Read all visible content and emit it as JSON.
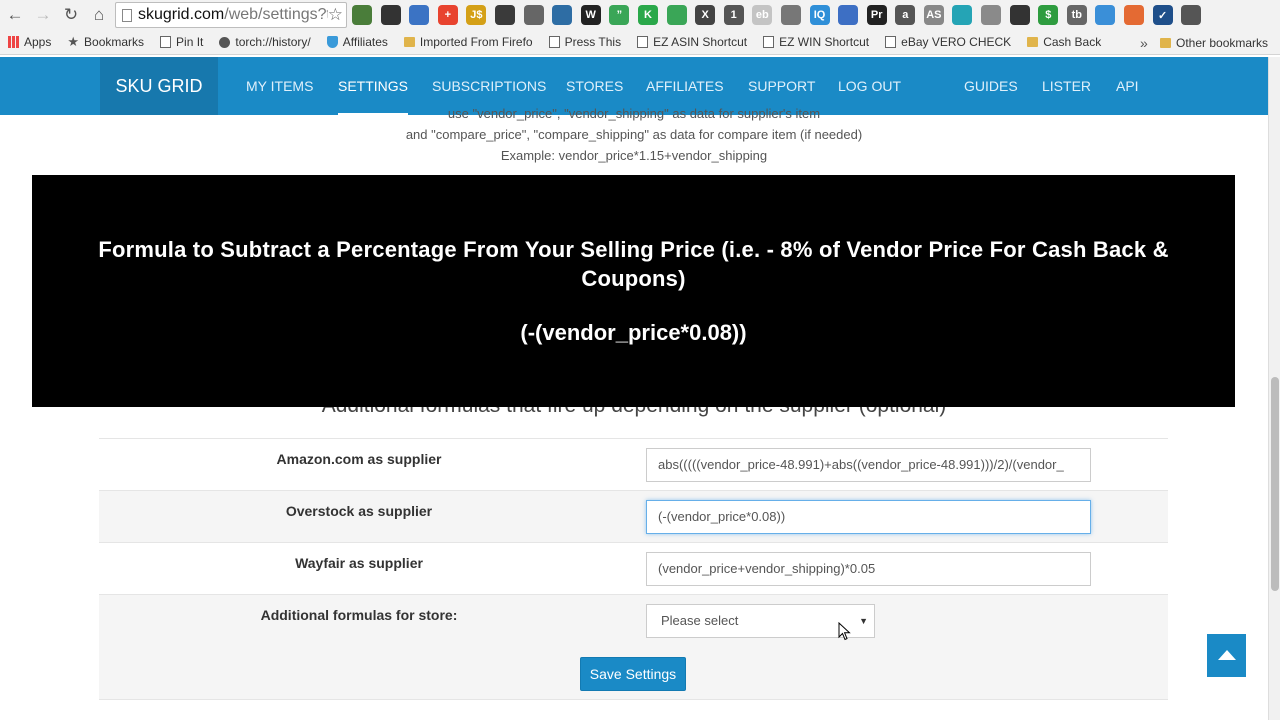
{
  "browser": {
    "url_host": "skugrid.com",
    "url_path": "/web/settings?t",
    "extensions": [
      {
        "icon": "eyedropper-icon",
        "glyph": "",
        "color": "#4a7d3a"
      },
      {
        "icon": "magnifier-icon",
        "glyph": "",
        "color": "#333333"
      },
      {
        "icon": "download-arrow-icon",
        "glyph": "",
        "color": "#3b73c4"
      },
      {
        "icon": "plus-circle-icon",
        "glyph": "+",
        "color": "#e8432f"
      },
      {
        "icon": "js-icon",
        "glyph": "J$",
        "color": "#d4a017"
      },
      {
        "icon": "terminal-icon",
        "glyph": "",
        "color": "#3a3a3a"
      },
      {
        "icon": "checklist-icon",
        "glyph": "",
        "color": "#666666"
      },
      {
        "icon": "chart-icon",
        "glyph": "",
        "color": "#2e6da4"
      },
      {
        "icon": "wordpress-w-icon",
        "glyph": "W",
        "color": "#222222"
      },
      {
        "icon": "quote-icon",
        "glyph": "”",
        "color": "#3aa657"
      },
      {
        "icon": "k-icon",
        "glyph": "K",
        "color": "#2aa84a"
      },
      {
        "icon": "pin-icon",
        "glyph": "",
        "color": "#3aa657"
      },
      {
        "icon": "x-icon",
        "glyph": "X",
        "color": "#444444"
      },
      {
        "icon": "eye-badge-icon",
        "glyph": "1",
        "color": "#555555"
      },
      {
        "icon": "ebay-icon",
        "glyph": "eb",
        "color": "#c4c4c4"
      },
      {
        "icon": "disc-icon",
        "glyph": "",
        "color": "#777777"
      },
      {
        "icon": "iq-icon",
        "glyph": "IQ",
        "color": "#2f8fd8"
      },
      {
        "icon": "globe-icon",
        "glyph": "",
        "color": "#3d6fc4"
      },
      {
        "icon": "pr-icon",
        "glyph": "Pr",
        "color": "#222222"
      },
      {
        "icon": "amazon-icon",
        "glyph": "a",
        "color": "#555555"
      },
      {
        "icon": "asin-power-icon",
        "glyph": "AS",
        "color": "#888888"
      },
      {
        "icon": "bag-icon",
        "glyph": "",
        "color": "#25a4b5"
      },
      {
        "icon": "forward-arrow-icon",
        "glyph": "",
        "color": "#8a8a8a"
      },
      {
        "icon": "camera-icon",
        "glyph": "",
        "color": "#333333"
      },
      {
        "icon": "dollar-icon",
        "glyph": "$",
        "color": "#2e9c3f"
      },
      {
        "icon": "tb-icon",
        "glyph": "tb",
        "color": "#666666"
      },
      {
        "icon": "refresh-circle-icon",
        "glyph": "",
        "color": "#3a8fd8"
      },
      {
        "icon": "tag-icon",
        "glyph": "",
        "color": "#e46a33"
      },
      {
        "icon": "checkbox-icon",
        "glyph": "✓",
        "color": "#1f4f8a"
      },
      {
        "icon": "mail-icon",
        "glyph": "",
        "color": "#555555"
      }
    ],
    "bookmarks": [
      {
        "label": "Apps",
        "icon": "apps-grid-icon",
        "kind": "apps"
      },
      {
        "label": "Bookmarks",
        "icon": "star-icon",
        "kind": "star"
      },
      {
        "label": "Pin It",
        "icon": "page-icon",
        "kind": "page"
      },
      {
        "label": "torch://history/",
        "icon": "history-icon",
        "kind": "clock"
      },
      {
        "label": "Affiliates",
        "icon": "shield-icon",
        "kind": "shield"
      },
      {
        "label": "Imported From Firefo",
        "icon": "folder-icon",
        "kind": "folder"
      },
      {
        "label": "Press This",
        "icon": "page-icon",
        "kind": "page"
      },
      {
        "label": "EZ ASIN Shortcut",
        "icon": "page-icon",
        "kind": "page"
      },
      {
        "label": "EZ WIN Shortcut",
        "icon": "page-icon",
        "kind": "page"
      },
      {
        "label": "eBay VERO CHECK",
        "icon": "page-icon",
        "kind": "page"
      },
      {
        "label": "Cash Back",
        "icon": "folder-icon",
        "kind": "folder"
      }
    ],
    "bookmarks_more": "»",
    "other_bookmarks": "Other bookmarks"
  },
  "nav": {
    "brand": "SKU GRID",
    "links": [
      {
        "label": "MY ITEMS",
        "active": false
      },
      {
        "label": "SETTINGS",
        "active": true
      },
      {
        "label": "SUBSCRIPTIONS",
        "active": false
      },
      {
        "label": "STORES",
        "active": false
      },
      {
        "label": "AFFILIATES",
        "active": false
      },
      {
        "label": "SUPPORT",
        "active": false
      },
      {
        "label": "LOG OUT",
        "active": false
      },
      {
        "label": "GUIDES",
        "active": false
      },
      {
        "label": "LISTER",
        "active": false
      },
      {
        "label": "API",
        "active": false
      }
    ]
  },
  "instructions": {
    "line1": "use \"vendor_price\", \"vendor_shipping\" as data for supplier's item",
    "line2": "and \"compare_price\", \"compare_shipping\" as data for compare item (if needed)",
    "line3": "Example: vendor_price*1.15+vendor_shipping"
  },
  "overlay": {
    "title": "Formula to Subtract a Percentage From Your Selling Price (i.e. - 8% of Vendor Price For Cash Back & Coupons)",
    "formula": "(-(vendor_price*0.08))"
  },
  "section_heading": "Additional formulas that fire up depending on the supplier (optional)",
  "formulas": [
    {
      "label": "Amazon.com as supplier",
      "value": "abs(((((vendor_price-48.991)+abs((vendor_price-48.991)))/2)/(vendor_"
    },
    {
      "label": "Overstock as supplier",
      "value": "(-(vendor_price*0.08))"
    },
    {
      "label": "Wayfair as supplier",
      "value": "(vendor_price+vendor_shipping)*0.05"
    }
  ],
  "store_formulas": {
    "label": "Additional formulas for store:",
    "selected": "Please select"
  },
  "save_label": "Save Settings",
  "colors": {
    "accent": "#1a8ac6",
    "accent_dark": "#1778ad",
    "overlay_bg": "#000000"
  }
}
